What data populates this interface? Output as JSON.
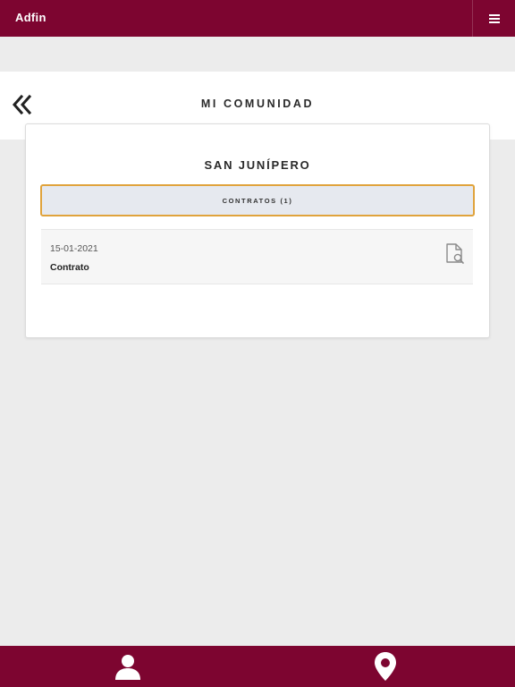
{
  "app": {
    "brand": "Adfin"
  },
  "header": {
    "title": "MI COMUNIDAD"
  },
  "community": {
    "name": "SAN JUNÍPERO",
    "tab_label": "CONTRATOS (1)",
    "documents": [
      {
        "date": "15-01-2021",
        "name": "Contrato"
      }
    ]
  },
  "icons": {
    "menu": "hamburger-menu-icon",
    "back": "double-chevron-left-icon",
    "document": "document-search-icon",
    "user": "user-icon",
    "location": "location-pin-icon"
  },
  "colors": {
    "brand": "#7d0530",
    "tab_border": "#e0a33c",
    "tab_background": "#e6e9ef",
    "page_background": "#ececec"
  }
}
